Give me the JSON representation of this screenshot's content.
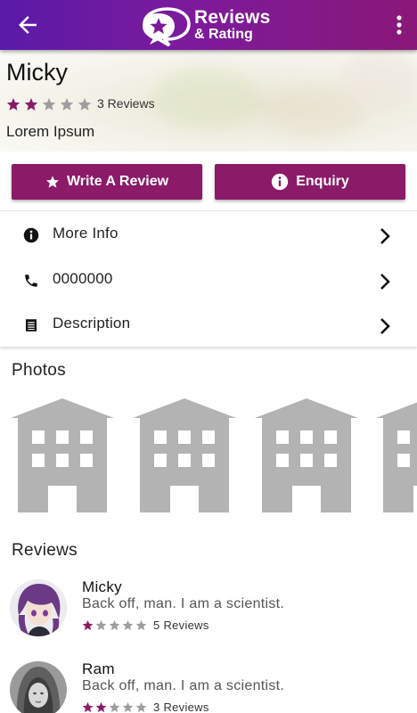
{
  "appbar": {
    "logo_title": "Reviews",
    "logo_subtitle": "& Rating",
    "back_icon": "arrow-left-icon",
    "menu_icon": "more-vertical-icon"
  },
  "profile": {
    "name": "Micky",
    "rating": 2,
    "rating_max": 5,
    "review_count_text": "3 Reviews",
    "tagline": "Lorem Ipsum"
  },
  "actions": {
    "write_review_label": "Write A Review",
    "enquiry_label": "Enquiry"
  },
  "info_items": [
    {
      "label": "More Info",
      "icon": "info-icon"
    },
    {
      "label": "0000000",
      "icon": "phone-icon"
    },
    {
      "label": "Description",
      "icon": "document-icon"
    }
  ],
  "photos": {
    "title": "Photos",
    "placeholder_icon": "building-icon"
  },
  "reviews": {
    "title": "Reviews",
    "items": [
      {
        "name": "Micky",
        "text": "Back off, man. I am a scientist.",
        "rating": 1,
        "count_text": "5 Reviews"
      },
      {
        "name": "Ram",
        "text": "Back off, man. I am a scientist.",
        "rating": 2,
        "count_text": "3 Reviews"
      }
    ]
  },
  "colors": {
    "primary": "#8b1a68",
    "appbar_start": "#5a1aa8",
    "appbar_end": "#8a1878",
    "star_filled": "#8b1a68",
    "star_empty": "#9e9e9e",
    "placeholder_gray": "#b3b3b3"
  }
}
